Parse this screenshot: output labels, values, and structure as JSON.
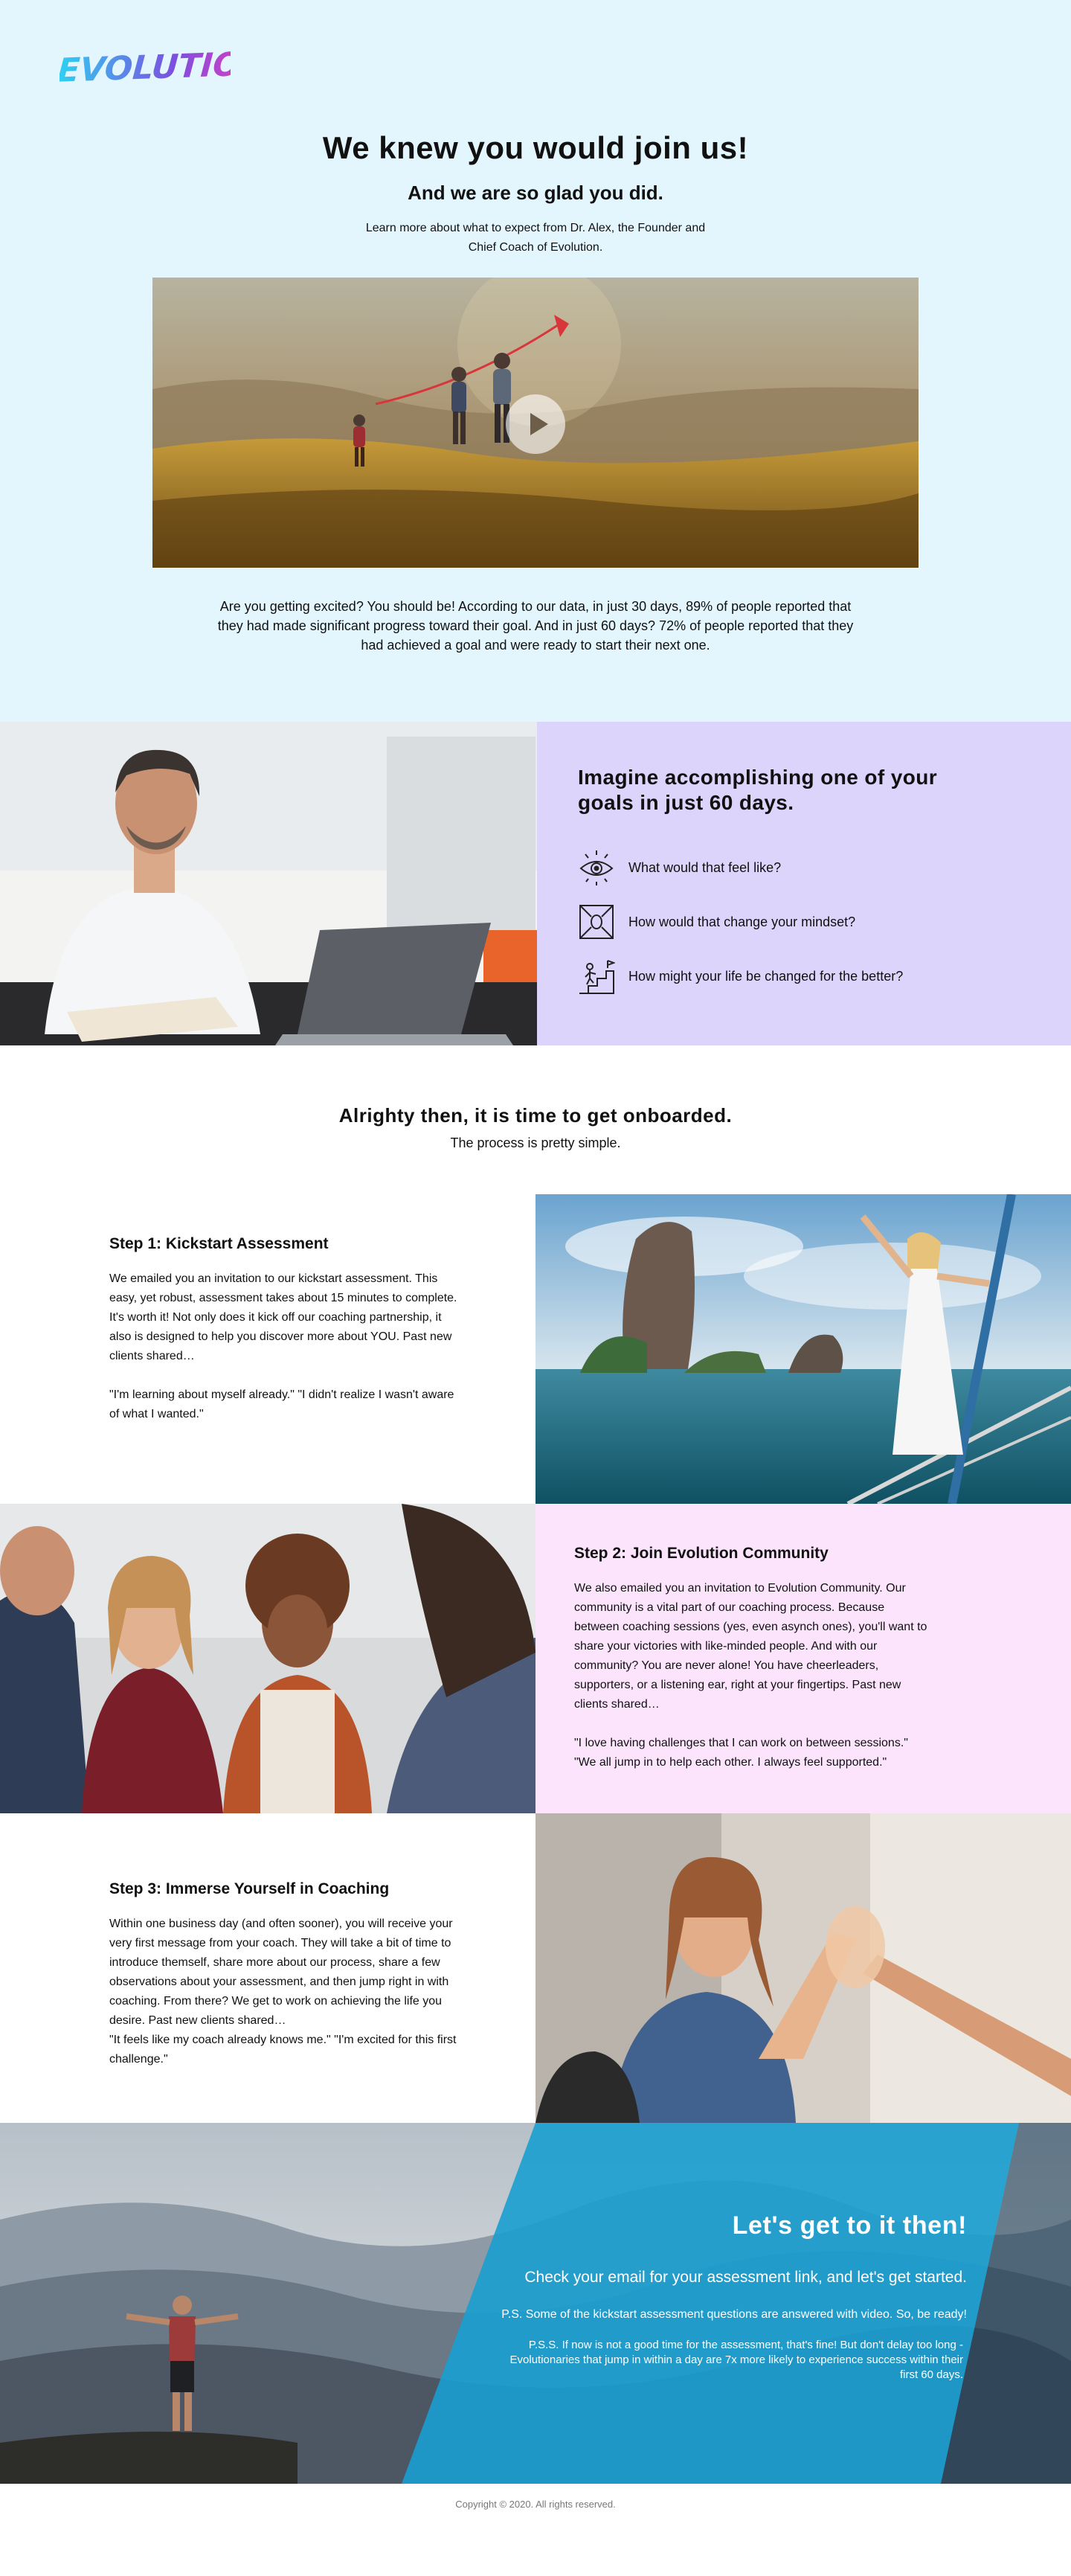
{
  "brand": {
    "logo_text": "EVOLUTION"
  },
  "hero": {
    "title": "We knew you would join us!",
    "subtitle": "And we are so glad you did.",
    "lead": "Learn more about what to expect from Dr. Alex, the Founder and Chief Coach of Evolution.",
    "body": "Are you getting excited? You should be! According to our data, in just 30 days, 89% of people reported that they had made significant progress toward their goal. And in just 60 days? 72% of people reported that they had achieved a goal and were ready to start their next one."
  },
  "imagine": {
    "title": "Imagine accomplishing one of your goals in just 60 days.",
    "questions": [
      {
        "icon": "eye-icon",
        "text": "What would that feel like?"
      },
      {
        "icon": "mindset-arrows-icon",
        "text": "How would that change your mindset?"
      },
      {
        "icon": "stairs-climb-icon",
        "text": "How might your life be changed for the better?"
      }
    ]
  },
  "onboard": {
    "title": "Alrighty then, it is time to get onboarded.",
    "subtitle": "The process is pretty simple."
  },
  "steps": [
    {
      "title": "Step 1: Kickstart Assessment",
      "body": "We emailed you an invitation to our kickstart assessment. This easy, yet robust, assessment takes about 15 minutes to complete. It's worth it! Not only does it kick off our coaching partnership, it also is designed to help you discover more about YOU. Past new clients shared…",
      "quote": "\"I'm learning about myself already.\" \"I didn't realize I wasn't aware of what I wanted.\""
    },
    {
      "title": "Step 2: Join Evolution Community",
      "body": "We also emailed you an invitation to Evolution Community. Our community is a vital part of our coaching process. Because between coaching sessions (yes, even asynch ones), you'll want to share your victories with like-minded people. And with our community? You are never alone! You have cheerleaders, supporters, or a listening ear, right at your fingertips. Past new clients shared…",
      "quote": "\"I love having challenges that I can work on between sessions.\" \"We all jump in to help each other. I always feel supported.\""
    },
    {
      "title": "Step 3: Immerse Yourself in Coaching",
      "body": "Within one business day (and often sooner), you will receive your very first message from your coach. They will take a bit of time to introduce themself, share more about our process, share a few observations about your assessment, and then jump right in with coaching. From there? We get to work on achieving the life you desire. Past new clients shared…",
      "quote": "\"It feels like my coach already knows me.\" \"I'm excited for this first challenge.\""
    }
  ],
  "final": {
    "title": "Let's get to it then!",
    "check": "Check your email for your assessment link, and let's get started.",
    "ps": "P.S. Some of the kickstart assessment questions are answered with video. So, be ready!",
    "pss": "P.S.S. If now is not a good time for the assessment, that's fine! But don't delay too long - Evolutionaries that jump in within a day are 7x more likely to experience success within their first 60 days."
  },
  "footer": {
    "copyright": "Copyright © 2020. All rights reserved."
  },
  "colors": {
    "hero_bg": "#e3f6fd",
    "imagine_bg": "#dcd4fa",
    "step2_bg": "#fbe4fc",
    "final_blue": "#1a9fd0",
    "logo_gradient": [
      "#2fd1f2",
      "#7b4fe0",
      "#f03bb8"
    ]
  }
}
